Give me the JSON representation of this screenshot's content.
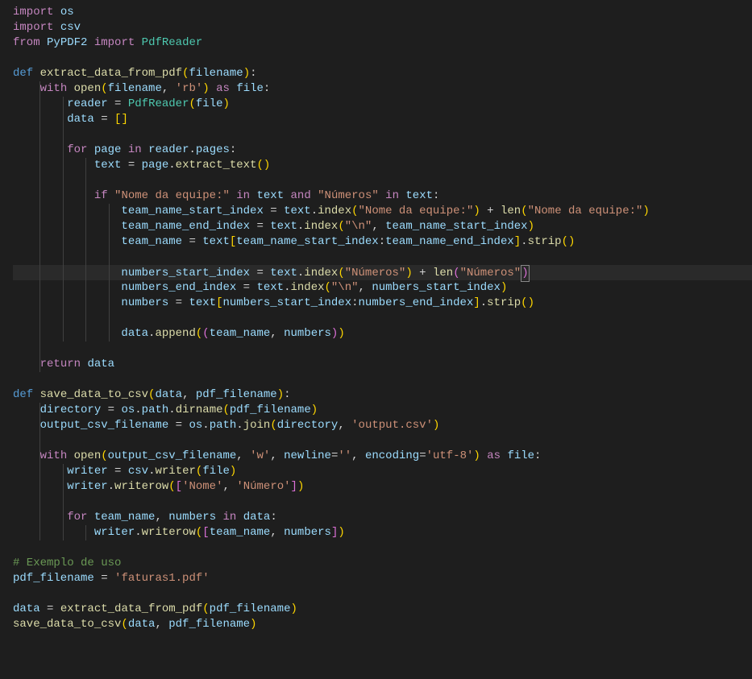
{
  "code": {
    "line1": {
      "import": "import",
      "module": "os"
    },
    "line2": {
      "import": "import",
      "module": "csv"
    },
    "line3": {
      "from": "from",
      "module": "PyPDF2",
      "import": "import",
      "name": "PdfReader"
    },
    "line5": {
      "def": "def",
      "name": "extract_data_from_pdf",
      "param": "filename"
    },
    "line6": {
      "with": "with",
      "open": "open",
      "arg1": "filename",
      "arg2": "'rb'",
      "as": "as",
      "var": "file"
    },
    "line7": {
      "var": "reader",
      "cls": "PdfReader",
      "arg": "file"
    },
    "line8": {
      "var": "data"
    },
    "line10": {
      "for": "for",
      "var": "page",
      "in": "in",
      "iter1": "reader",
      "iter2": "pages"
    },
    "line11": {
      "var": "text",
      "obj": "page",
      "method": "extract_text"
    },
    "line13": {
      "if": "if",
      "str1": "\"Nome da equipe:\"",
      "in1": "in",
      "var1": "text",
      "and": "and",
      "str2": "\"Números\"",
      "in2": "in",
      "var2": "text"
    },
    "line14": {
      "var": "team_name_start_index",
      "obj": "text",
      "method": "index",
      "arg": "\"Nome da equipe:\"",
      "len": "len",
      "arg2": "\"Nome da equipe:\""
    },
    "line15": {
      "var": "team_name_end_index",
      "obj": "text",
      "method": "index",
      "arg1": "\"\\n\"",
      "arg2": "team_name_start_index"
    },
    "line16": {
      "var": "team_name",
      "obj": "text",
      "idx1": "team_name_start_index",
      "idx2": "team_name_end_index",
      "method": "strip"
    },
    "line18": {
      "var": "numbers_start_index",
      "obj": "text",
      "method": "index",
      "arg": "\"Números\"",
      "len": "len",
      "arg2": "\"Números\""
    },
    "line19": {
      "var": "numbers_end_index",
      "obj": "text",
      "method": "index",
      "arg1": "\"\\n\"",
      "arg2": "numbers_start_index"
    },
    "line20": {
      "var": "numbers",
      "obj": "text",
      "idx1": "numbers_start_index",
      "idx2": "numbers_end_index",
      "method": "strip"
    },
    "line22": {
      "obj": "data",
      "method": "append",
      "arg1": "team_name",
      "arg2": "numbers"
    },
    "line24": {
      "return": "return",
      "var": "data"
    },
    "line26": {
      "def": "def",
      "name": "save_data_to_csv",
      "param1": "data",
      "param2": "pdf_filename"
    },
    "line27": {
      "var": "directory",
      "obj1": "os",
      "obj2": "path",
      "method": "dirname",
      "arg": "pdf_filename"
    },
    "line28": {
      "var": "output_csv_filename",
      "obj1": "os",
      "obj2": "path",
      "method": "join",
      "arg1": "directory",
      "arg2": "'output.csv'"
    },
    "line30": {
      "with": "with",
      "open": "open",
      "arg1": "output_csv_filename",
      "arg2": "'w'",
      "kw1": "newline",
      "val1": "''",
      "kw2": "encoding",
      "val2": "'utf-8'",
      "as": "as",
      "var": "file"
    },
    "line31": {
      "var": "writer",
      "obj": "csv",
      "method": "writer",
      "arg": "file"
    },
    "line32": {
      "obj": "writer",
      "method": "writerow",
      "arg1": "'Nome'",
      "arg2": "'Número'"
    },
    "line34": {
      "for": "for",
      "var1": "team_name",
      "var2": "numbers",
      "in": "in",
      "iter": "data"
    },
    "line35": {
      "obj": "writer",
      "method": "writerow",
      "arg1": "team_name",
      "arg2": "numbers"
    },
    "line37": {
      "comment": "# Exemplo de uso"
    },
    "line38": {
      "var": "pdf_filename",
      "val": "'faturas1.pdf'"
    },
    "line40": {
      "var": "data",
      "func": "extract_data_from_pdf",
      "arg": "pdf_filename"
    },
    "line41": {
      "func": "save_data_to_csv",
      "arg1": "data",
      "arg2": "pdf_filename"
    }
  }
}
